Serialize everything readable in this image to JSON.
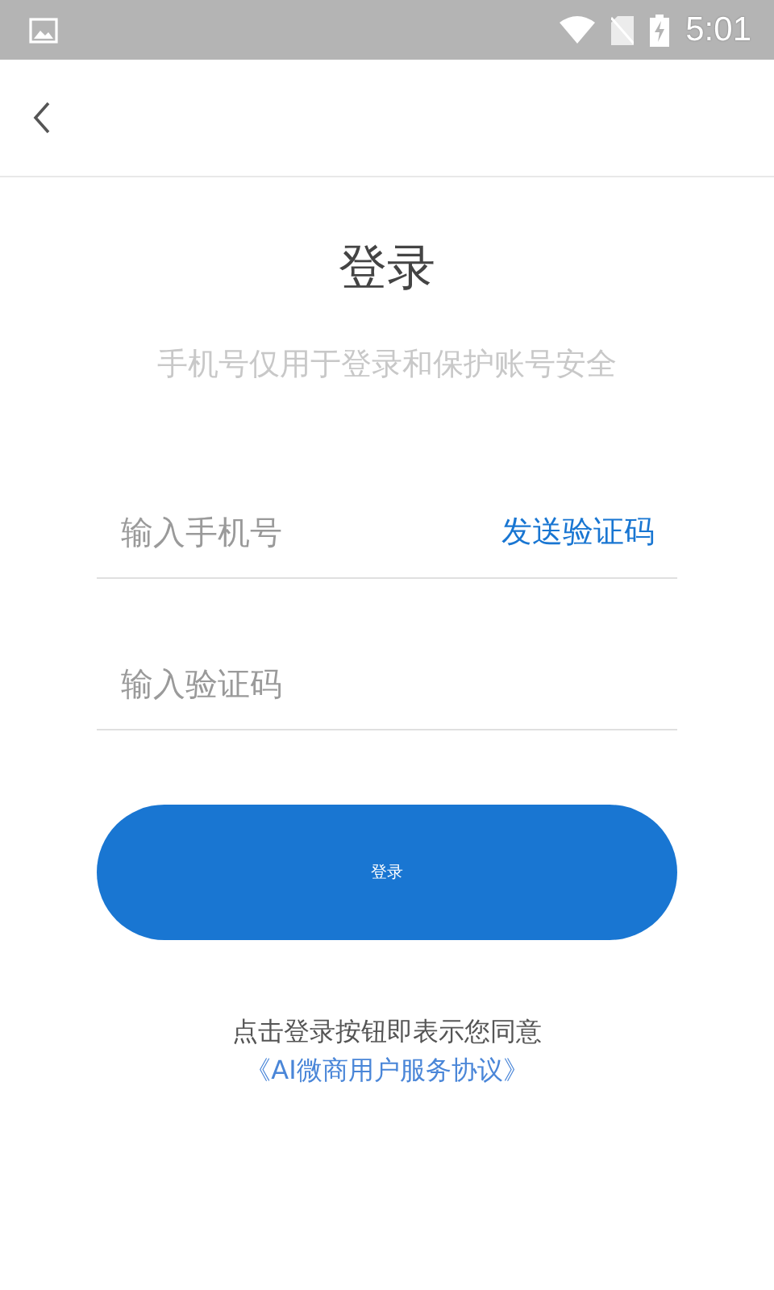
{
  "status_bar": {
    "time": "5:01"
  },
  "title": "登录",
  "subtitle": "手机号仅用于登录和保护账号安全",
  "phone_field": {
    "placeholder": "输入手机号",
    "action": "发送验证码"
  },
  "code_field": {
    "placeholder": "输入验证码"
  },
  "login_button": "登录",
  "agreement": {
    "text": "点击登录按钮即表示您同意",
    "link": "《AI微商用户服务协议》"
  }
}
